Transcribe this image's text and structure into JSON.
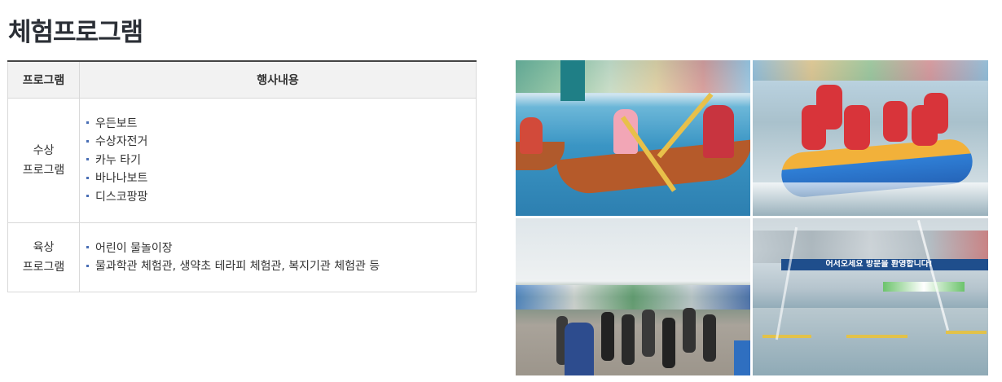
{
  "page_title": "체험프로그램",
  "table": {
    "headers": [
      "프로그램",
      "행사내용"
    ],
    "rows": [
      {
        "category": [
          "수상",
          "프로그램"
        ],
        "items": [
          "우든보트",
          "수상자전거",
          "카누 타기",
          "바나나보트",
          "디스코팡팡"
        ]
      },
      {
        "category": [
          "육상",
          "프로그램"
        ],
        "items": [
          "어린이 물놀이장",
          "물과학관 체험관, 생약초 테라피 체험관, 복지기관 체험관 등"
        ]
      }
    ]
  },
  "photos": {
    "canoe": {
      "alt": "canoe-photo"
    },
    "tube": {
      "alt": "water-tube-photo"
    },
    "crowd": {
      "alt": "crowd-photo"
    },
    "fountain": {
      "alt": "fountain-photo",
      "banner_text": "어서오세요 방문을 환영합니다!"
    }
  },
  "colors": {
    "bullet": "#4a6fb5",
    "header_bg": "#f2f2f2",
    "title": "#2b2f36"
  }
}
